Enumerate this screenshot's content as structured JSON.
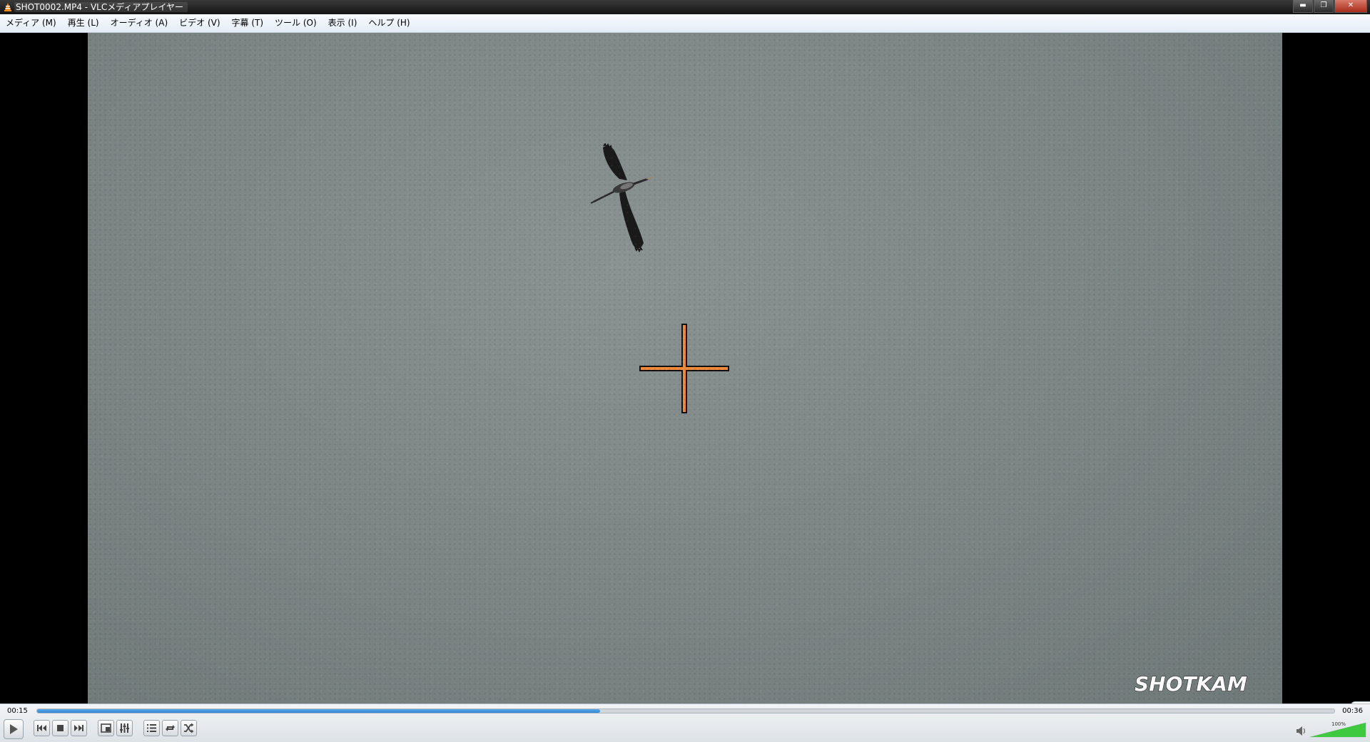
{
  "window": {
    "title": "SHOT0002.MP4 - VLCメディアプレイヤー",
    "buttons": {
      "minimize": "▬",
      "maximize": "❐",
      "close": "✕"
    }
  },
  "menu": {
    "items": [
      {
        "label": "メディア (M)"
      },
      {
        "label": "再生 (L)"
      },
      {
        "label": "オーディオ (A)"
      },
      {
        "label": "ビデオ (V)"
      },
      {
        "label": "字幕 (T)"
      },
      {
        "label": "ツール (O)"
      },
      {
        "label": "表示 (I)"
      },
      {
        "label": "ヘルプ (H)"
      }
    ]
  },
  "video": {
    "watermark": "SHOTKAM",
    "crosshair_color": "#f08a3a"
  },
  "playback": {
    "elapsed": "00:15",
    "total": "00:36",
    "progress": 0.434
  },
  "volume": {
    "level_text": "100%",
    "level": 1.0
  },
  "icons": {
    "play": "play-icon",
    "previous": "previous-icon",
    "stop": "stop-icon",
    "next": "next-icon",
    "fullscreen": "fullscreen-icon",
    "extended_settings": "equalizer-icon",
    "playlist": "playlist-icon",
    "loop": "loop-icon",
    "shuffle": "shuffle-icon",
    "speaker": "speaker-icon"
  },
  "colors": {
    "accent": "#2f86d6",
    "titlebar": "#1e1e1e",
    "sky": "#7e8786"
  }
}
